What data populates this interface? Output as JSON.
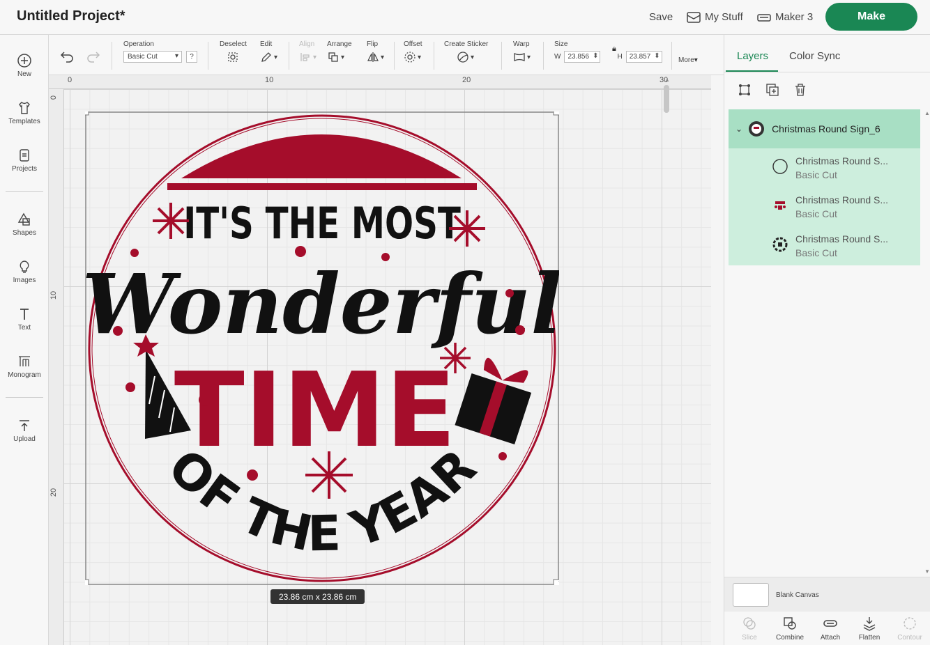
{
  "header": {
    "project_title": "Untitled Project*",
    "save_label": "Save",
    "my_stuff_label": "My Stuff",
    "machine_label": "Maker 3",
    "make_label": "Make"
  },
  "left_toolbar": {
    "new": "New",
    "templates": "Templates",
    "projects": "Projects",
    "shapes": "Shapes",
    "images": "Images",
    "text": "Text",
    "monogram": "Monogram",
    "upload": "Upload"
  },
  "edit_toolbar": {
    "operation_label": "Operation",
    "operation_value": "Basic Cut",
    "help": "?",
    "deselect": "Deselect",
    "edit": "Edit",
    "align": "Align",
    "arrange": "Arrange",
    "flip": "Flip",
    "offset": "Offset",
    "create_sticker": "Create Sticker",
    "warp": "Warp",
    "size_label": "Size",
    "w_label": "W",
    "w_value": "23.856",
    "h_label": "H",
    "h_value": "23.857",
    "more": "More"
  },
  "canvas": {
    "ruler_top": [
      "0",
      "10",
      "20",
      "30"
    ],
    "ruler_left": [
      "0",
      "10",
      "20"
    ],
    "size_readout": "23.86  cm x 23.86  cm",
    "design_text": {
      "line1": "IT'S THE MOST",
      "line2": "Wonderful",
      "line3": "TIME",
      "line4": "OF THE YEAR"
    }
  },
  "layers_panel": {
    "tab_layers": "Layers",
    "tab_color_sync": "Color Sync",
    "group_name": "Christmas Round Sign_6",
    "children": [
      {
        "name": "Christmas Round S...",
        "op": "Basic Cut"
      },
      {
        "name": "Christmas Round S...",
        "op": "Basic Cut"
      },
      {
        "name": "Christmas Round S...",
        "op": "Basic Cut"
      }
    ],
    "blank_canvas": "Blank Canvas",
    "bottom_tools": {
      "slice": "Slice",
      "combine": "Combine",
      "attach": "Attach",
      "flatten": "Flatten",
      "contour": "Contour"
    }
  },
  "colors": {
    "accent": "#1a8754",
    "design_red": "#a50d2b",
    "design_black": "#111111",
    "layer_highlight": "#a8dfc4"
  }
}
